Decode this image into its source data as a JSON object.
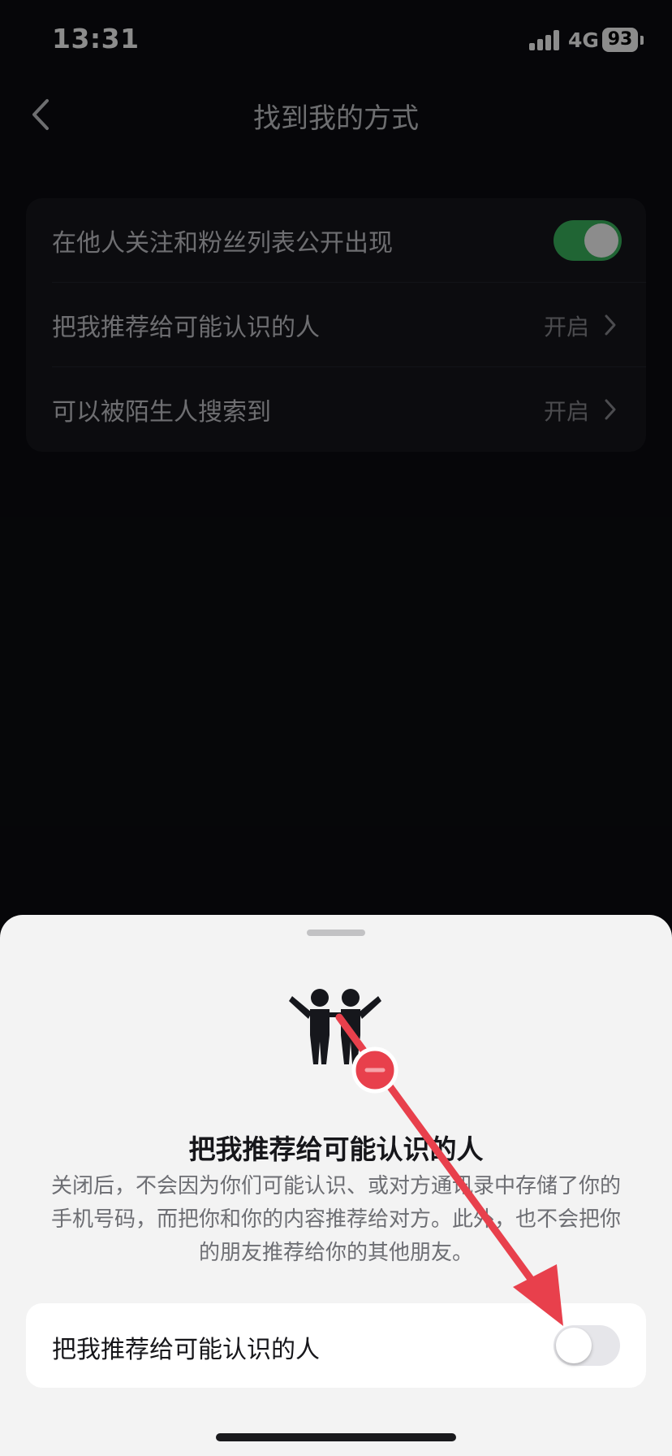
{
  "status_bar": {
    "time": "13:31",
    "network": "4G",
    "battery": "93"
  },
  "nav": {
    "title": "找到我的方式",
    "back_icon": "chevron-left-icon"
  },
  "settings": {
    "rows": [
      {
        "label": "在他人关注和粉丝列表公开出现",
        "control": "toggle",
        "enabled": true
      },
      {
        "label": "把我推荐给可能认识的人",
        "value": "开启"
      },
      {
        "label": "可以被陌生人搜索到",
        "value": "开启"
      }
    ]
  },
  "sheet": {
    "icon": "two-people-icon",
    "title": "把我推荐给可能认识的人",
    "description": "关闭后，不会因为你们可能认识、或对方通讯录中存储了你的手机号码，而把你和你的内容推荐给对方。此外，也不会把你的朋友推荐给你的其他朋友。",
    "option": {
      "label": "把我推荐给可能认识的人",
      "enabled": false
    }
  },
  "colors": {
    "toggle_on": "#3bb95f",
    "annotation_red": "#e8404c",
    "background": "#0b0c11",
    "sheet_background": "#f3f3f3"
  }
}
